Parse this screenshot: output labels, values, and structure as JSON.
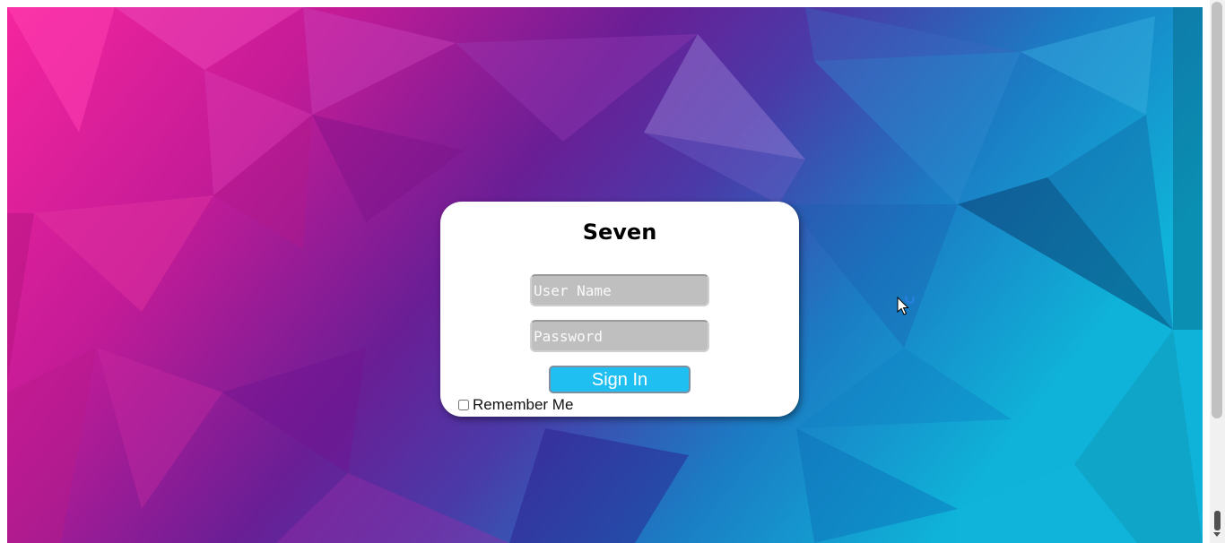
{
  "login": {
    "title": "Seven",
    "username_placeholder": "User Name",
    "password_placeholder": "Password",
    "signin_label": "Sign In",
    "remember_label": "Remember Me",
    "remember_checked": false
  },
  "colors": {
    "signin_button": "#1fbff2",
    "card_background": "#ffffff",
    "field_background": "#bfbfbf",
    "bg_left": "#e81c95",
    "bg_middle": "#6a1a8c",
    "bg_right": "#14a3d8"
  },
  "icons": {
    "cursor": "busy-cursor-icon"
  }
}
